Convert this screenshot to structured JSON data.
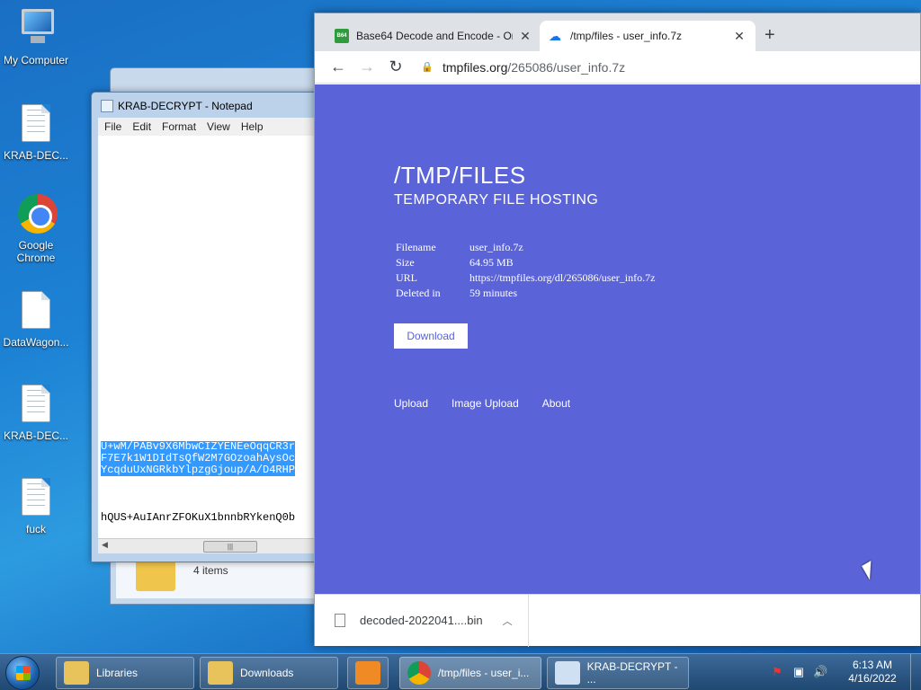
{
  "desktop": {
    "icons": [
      {
        "label": "My Computer",
        "kind": "computer-icon"
      },
      {
        "label": "KRAB-DEC...",
        "kind": "text-file-icon"
      },
      {
        "label": "Google Chrome",
        "kind": "chrome-icon"
      },
      {
        "label": "DataWagon...",
        "kind": "file-icon"
      },
      {
        "label": "KRAB-DEC...",
        "kind": "text-file-icon"
      },
      {
        "label": "fuck",
        "kind": "text-file-icon"
      }
    ]
  },
  "explorer": {
    "status": "4 items"
  },
  "notepad": {
    "title": "KRAB-DECRYPT - Notepad",
    "menu": [
      "File",
      "Edit",
      "Format",
      "View",
      "Help"
    ],
    "selected_lines": [
      "U+wM/PABv9X6MbwCIZYENEeOqqCR3r",
      "F7E7k1W1DIdTsQfW2M7GOzoahAysOc",
      "YcqduUxNGRkbYlpzgGjoup/A/D4RHP"
    ],
    "plain_line": "hQUS+AuIAnrZFOKuX1bnnbRYkenQ0b"
  },
  "chrome": {
    "tabs": [
      {
        "title": "Base64 Decode and Encode - Or",
        "favicon": "b64-icon"
      },
      {
        "title": "/tmp/files - user_info.7z",
        "favicon": "cloud-icon"
      }
    ],
    "url_host": "tmpfiles.org",
    "url_path": "/265086/user_info.7z",
    "page": {
      "heading": "/TMP/FILES",
      "subheading": "TEMPORARY FILE HOSTING",
      "info": [
        {
          "key": "Filename",
          "value": "user_info.7z"
        },
        {
          "key": "Size",
          "value": "64.95 MB"
        },
        {
          "key": "URL",
          "value": "https://tmpfiles.org/dl/265086/user_info.7z"
        },
        {
          "key": "Deleted in",
          "value": "59 minutes"
        }
      ],
      "download_label": "Download",
      "links": [
        "Upload",
        "Image Upload",
        "About"
      ],
      "background": "#5a63d8"
    },
    "download_item": "decoded-2022041....bin"
  },
  "taskbar": {
    "buttons": [
      {
        "label": "Libraries"
      },
      {
        "label": "Downloads"
      },
      {
        "label": ""
      },
      {
        "label": "/tmp/files - user_i..."
      },
      {
        "label": "KRAB-DECRYPT - ..."
      }
    ],
    "time": "6:13 AM",
    "date": "4/16/2022"
  }
}
